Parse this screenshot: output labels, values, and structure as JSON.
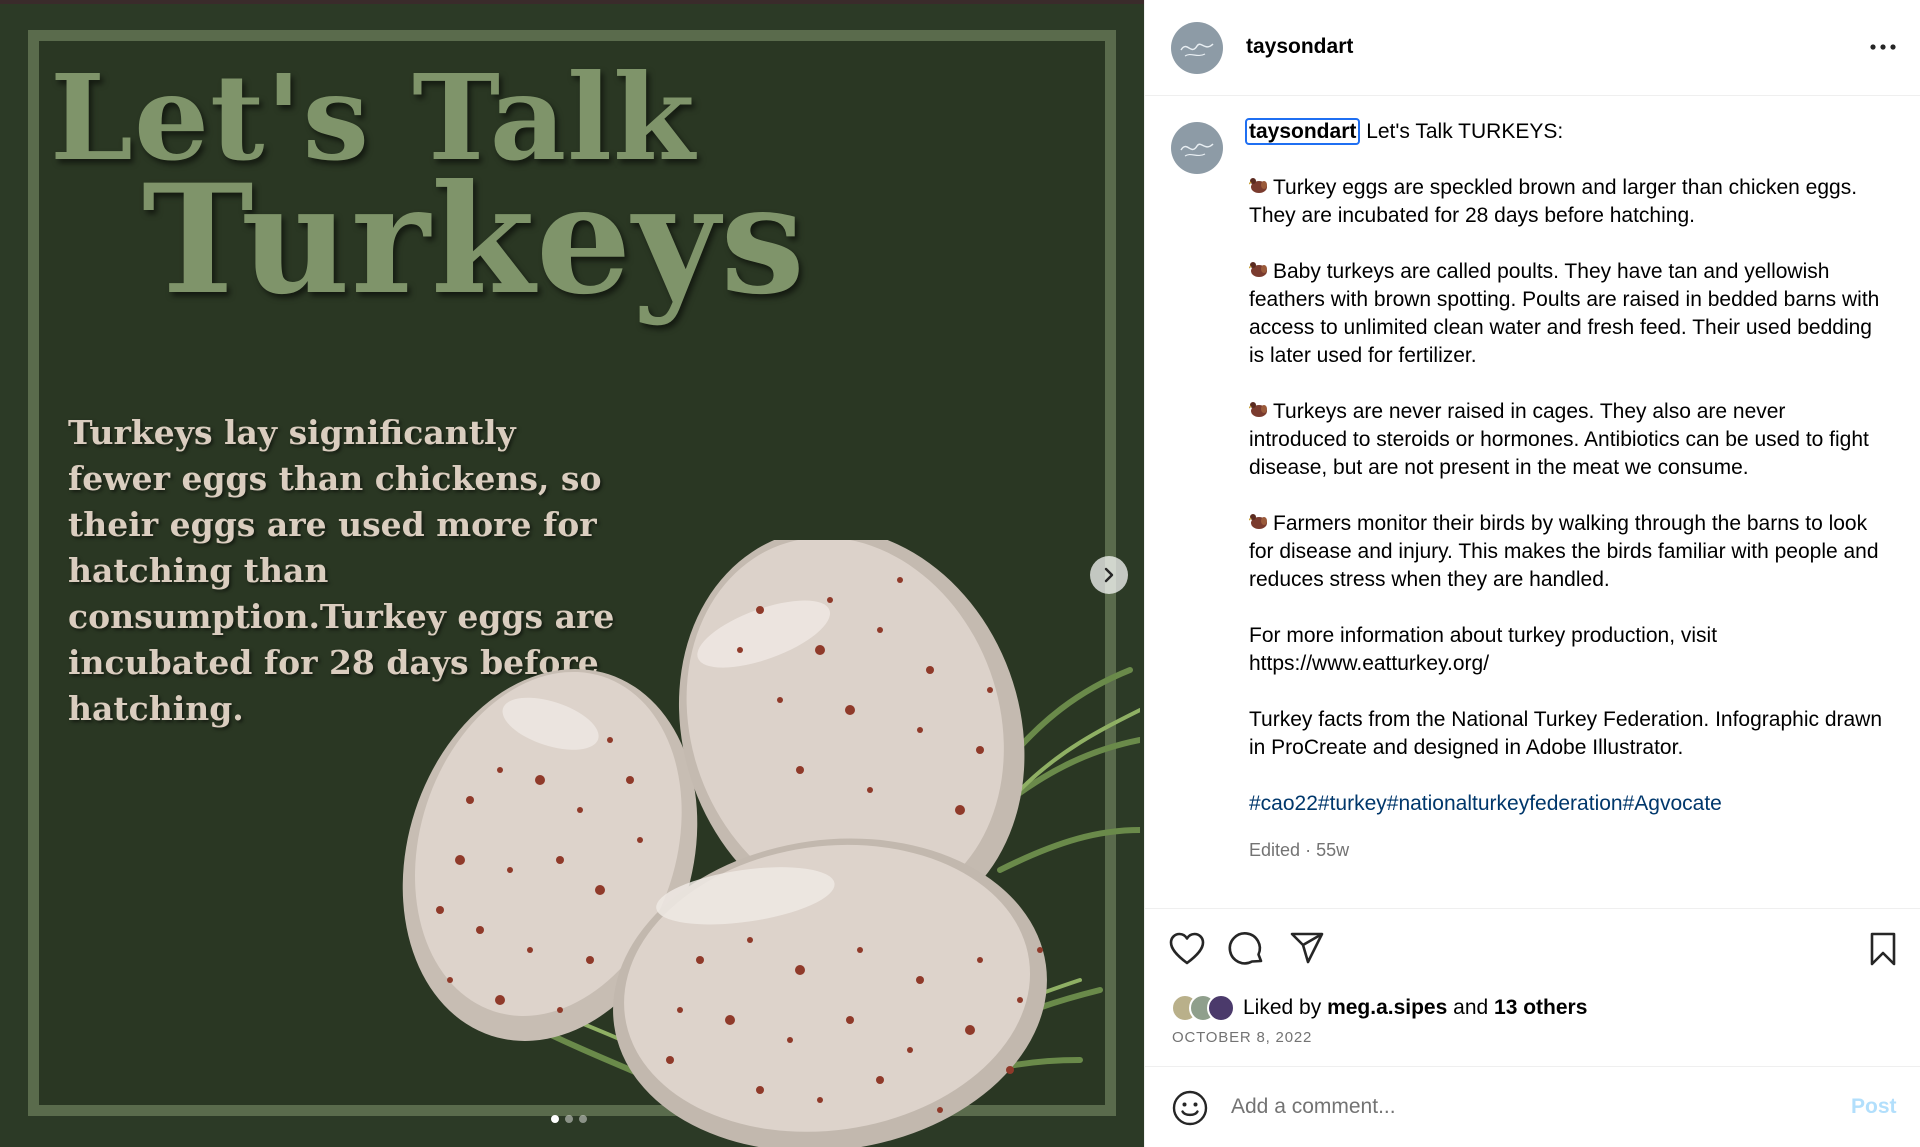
{
  "media": {
    "headline_line1": "Let's Talk",
    "headline_line2": "Turkeys",
    "body": "Turkeys lay significantly fewer eggs than chickens, so their eggs are used more for hatching than consumption.Turkey eggs are incubated for 28 days before hatching.",
    "carousel_count": 3,
    "carousel_active": 1,
    "next_icon": "chevron-right-icon"
  },
  "post": {
    "username": "taysondart",
    "more_icon": "ellipsis-icon"
  },
  "caption": {
    "username": "taysondart",
    "lead": "Let's Talk TURKEYS:",
    "bullet_icon": "turkey-emoji",
    "bullets": [
      "Turkey eggs are speckled brown and larger than chicken eggs. They are incubated for 28 days before hatching.",
      "Baby turkeys are called poults. They have tan and yellowish feathers with brown spotting. Poults are raised in bedded barns with access to unlimited clean water and fresh feed. Their used bedding is later used for fertilizer.",
      "Turkeys are never raised in cages. They also are never introduced to steroids or hormones. Antibiotics can be used to fight disease, but are not present in the meat we consume.",
      "Farmers monitor their birds by walking through the barns to look for disease and injury. This makes the birds familiar with people and reduces stress when they are handled."
    ],
    "more_info": "For more information about turkey production, visit https://www.eatturkey.org/",
    "credits": "Turkey facts from the National Turkey Federation. Infographic drawn in ProCreate and designed in Adobe Illustrator.",
    "hashtags": "#cao22#turkey#nationalturkeyfederation#Agvocate",
    "edited": "Edited",
    "separator": "·",
    "age": "55w"
  },
  "actions": {
    "like_icon": "heart-icon",
    "comment_icon": "comment-icon",
    "share_icon": "paper-plane-icon",
    "save_icon": "bookmark-icon"
  },
  "likes": {
    "prefix": "Liked by",
    "user": "meg.a.sipes",
    "conj": "and",
    "others": "13 others"
  },
  "date": "OCTOBER 8, 2022",
  "comment": {
    "placeholder": "Add a comment...",
    "post_label": "Post",
    "emoji_icon": "smiley-icon"
  },
  "colors": {
    "background_dark_green": "#2c3a26",
    "headline_green": "#7f946a",
    "egg_speckle": "#8f3a2a",
    "link_blue": "#00376b",
    "post_button_disabled": "#b2dffc"
  }
}
